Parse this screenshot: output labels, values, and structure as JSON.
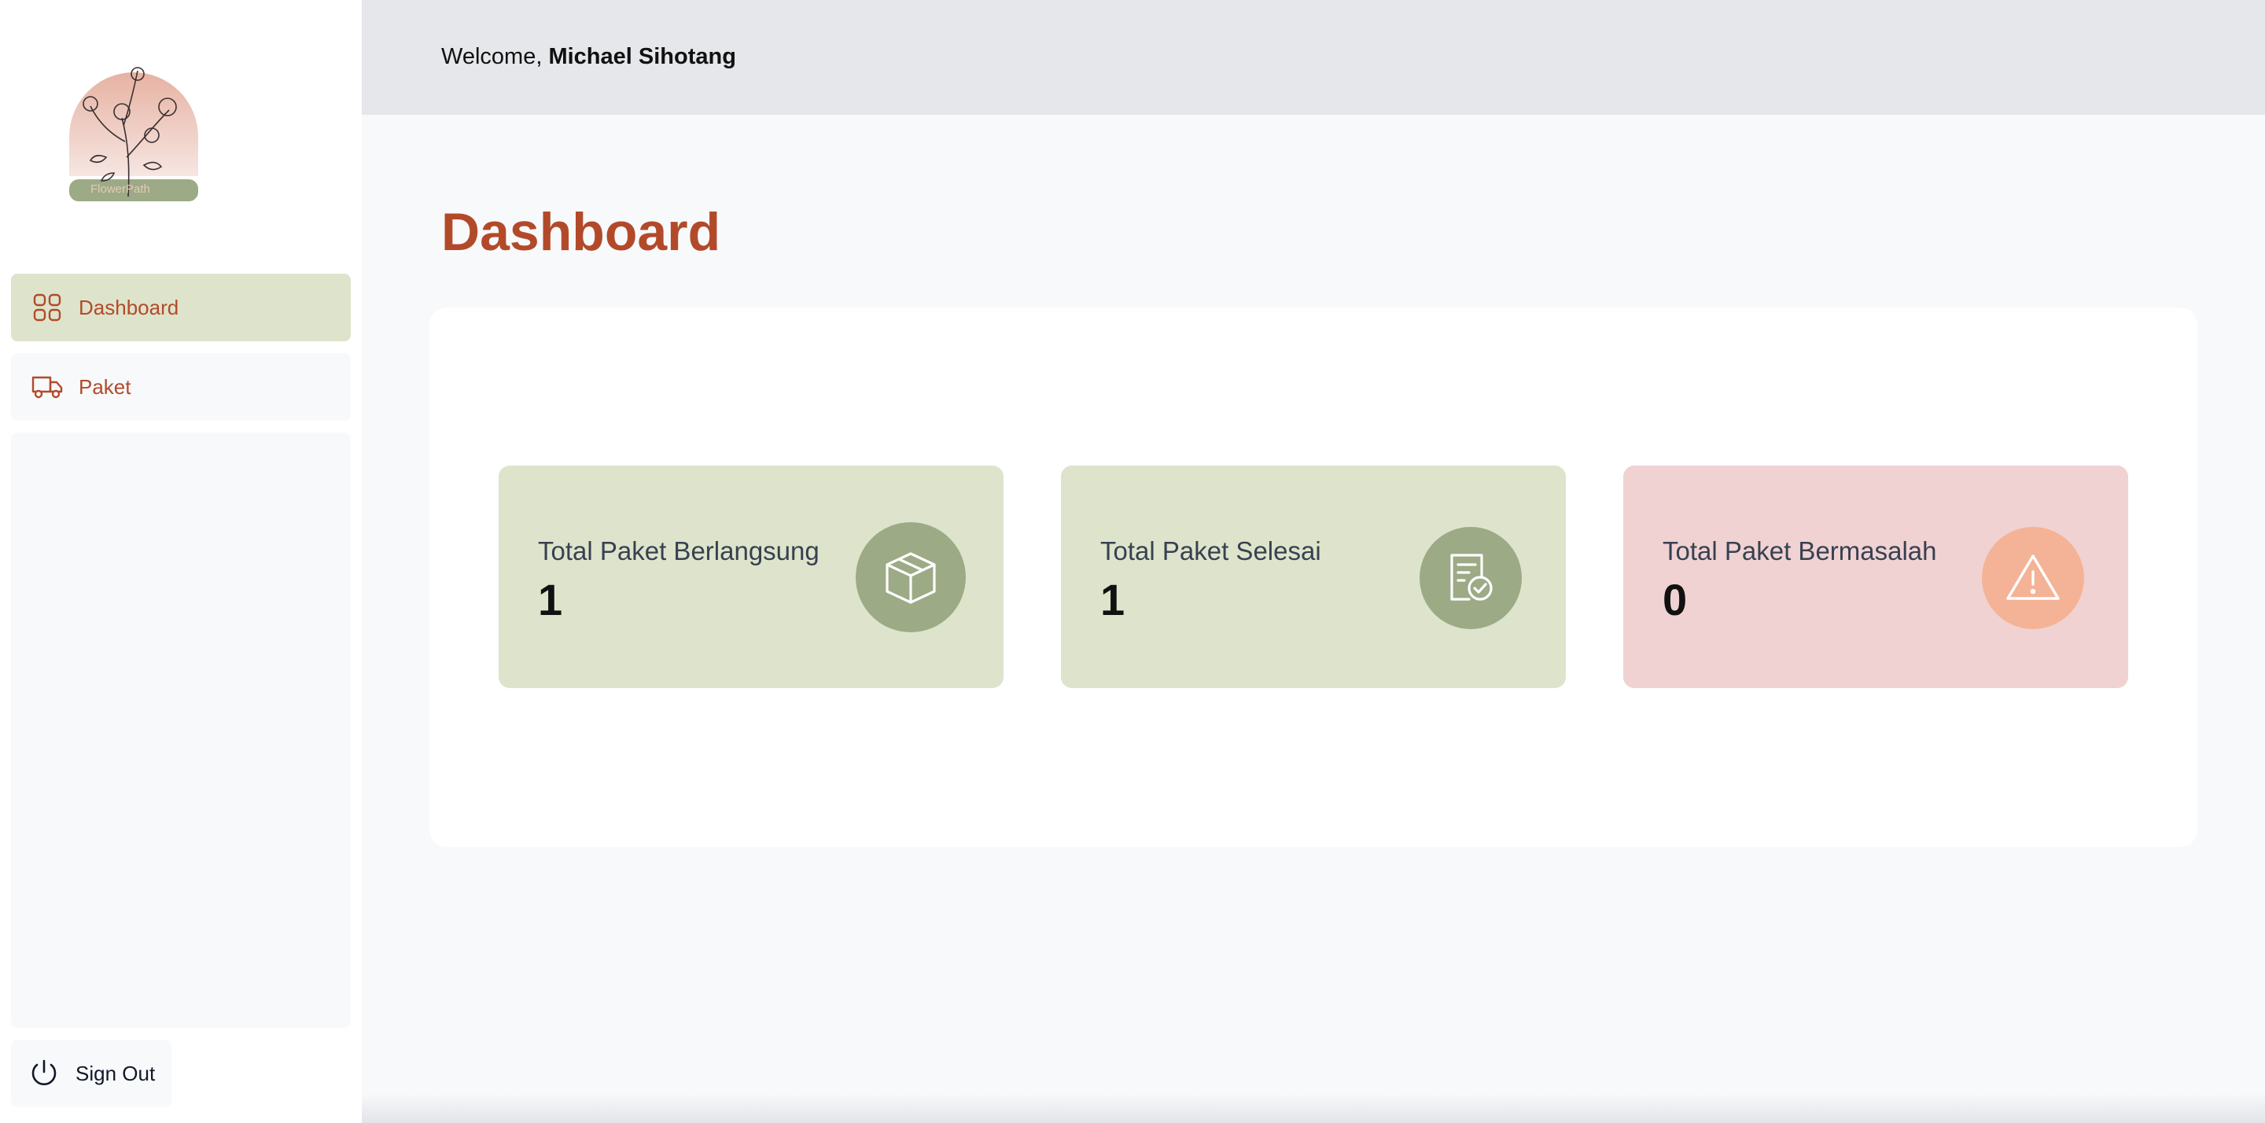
{
  "sidebar": {
    "logo_text": "FlowerPath",
    "items": [
      {
        "label": "Dashboard",
        "icon": "grid-icon",
        "active": true
      },
      {
        "label": "Paket",
        "icon": "truck-icon",
        "active": false
      }
    ],
    "signout_label": "Sign Out"
  },
  "header": {
    "welcome_prefix": "Welcome,",
    "user_name": "Michael Sihotang"
  },
  "main": {
    "title": "Dashboard",
    "cards": [
      {
        "label": "Total Paket Berlangsung",
        "value": "1",
        "icon": "box-icon",
        "color": "#dde4cb"
      },
      {
        "label": "Total Paket Selesai",
        "value": "1",
        "icon": "document-check-icon",
        "color": "#dde4cb"
      },
      {
        "label": "Total Paket Bermasalah",
        "value": "0",
        "icon": "warning-icon",
        "color": "#f0d2d2"
      }
    ]
  },
  "colors": {
    "accent": "#b24a2a",
    "sage": "#9caa86",
    "sage_light": "#dde4cb",
    "rose": "#f0d2d2",
    "peach": "#f4b396",
    "header_bg": "#e6e7eb"
  }
}
